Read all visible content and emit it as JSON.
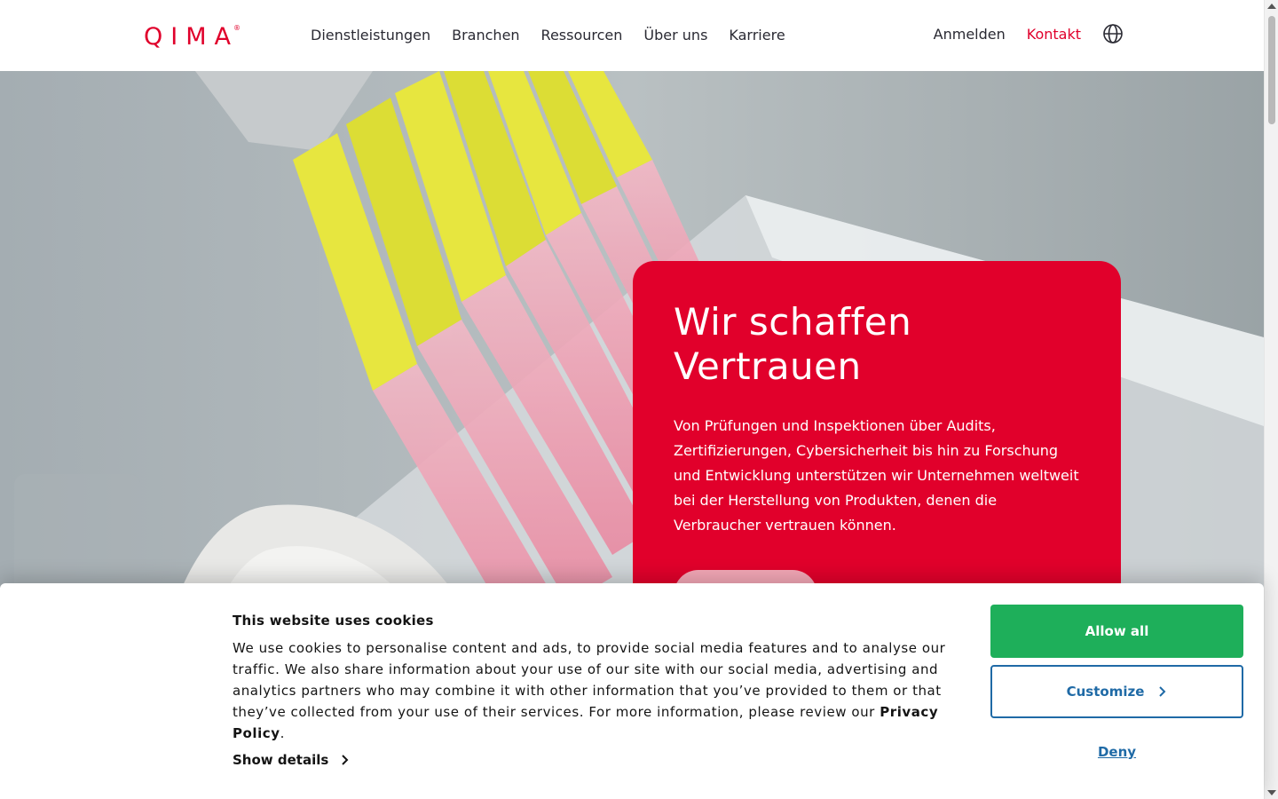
{
  "header": {
    "logo_text": "QIMA",
    "logo_mark": "®",
    "nav": [
      "Dienstleistungen",
      "Branchen",
      "Ressourcen",
      "Über uns",
      "Karriere"
    ],
    "login_label": "Anmelden",
    "contact_label": "Kontakt",
    "language_icon": "globe-icon"
  },
  "hero": {
    "title": "Wir schaffen Vertrauen",
    "text": "Von Prüfungen und Inspektionen über Audits, Zertifizierungen, Cybersicherheit bis hin zu Forschung und Entwicklung unterstützen wir Unternehmen weltweit bei der Herstellung von Produkten, denen die Verbraucher vertrauen können.",
    "image_alt": "Laboratory pipettes dispensing pink liquid"
  },
  "cookie": {
    "title": "This website uses cookies",
    "text": "We use cookies to personalise content and ads, to provide social media features and to analyse our traffic. We also share information about your use of our site with our social media, advertising and analytics partners who may combine it with other information that you’ve provided to them or that they’ve collected from your use of their services. For more information, please review our",
    "privacy_link": "Privacy Policy",
    "text_end": ".",
    "show_details": "Show details",
    "allow_all": "Allow all",
    "customize": "Customize",
    "deny": "Deny"
  },
  "colors": {
    "brand_red": "#e1002b",
    "allow_green": "#1eaf5a",
    "link_blue": "#1f6aa6"
  }
}
